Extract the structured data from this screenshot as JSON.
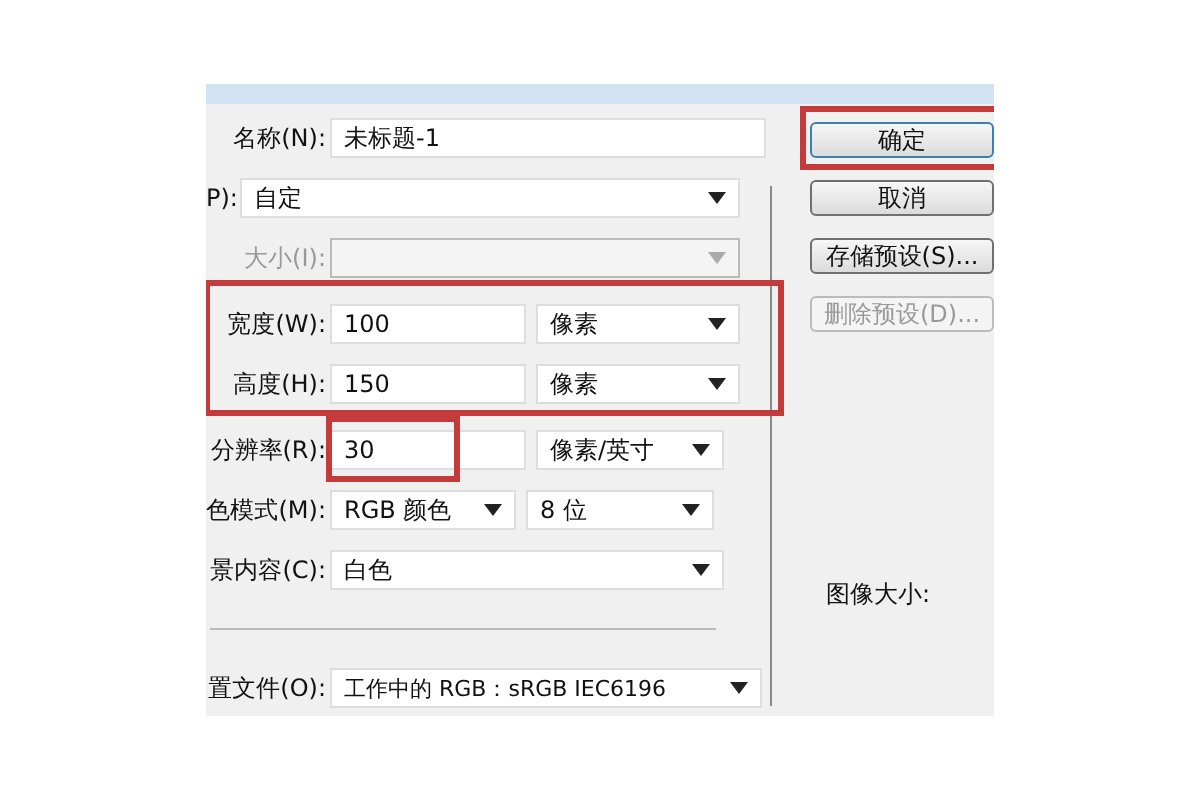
{
  "name": {
    "label": "名称(N):",
    "value": "未标题-1"
  },
  "preset": {
    "label": "P):",
    "value": "自定"
  },
  "size": {
    "label": "大小(I):",
    "disabled": true
  },
  "width": {
    "label": "宽度(W):",
    "value": "100",
    "unit": "像素"
  },
  "height": {
    "label": "高度(H):",
    "value": "150",
    "unit": "像素"
  },
  "size_marked": true,
  "resolution": {
    "label": "分辨率(R):",
    "value": "30",
    "unit": "像素/英寸",
    "marked": true
  },
  "color_mode": {
    "label": "色模式(M):",
    "value": "RGB 颜色",
    "unit": "8 位"
  },
  "background": {
    "label": "景内容(C):",
    "value": "白色"
  },
  "profile": {
    "label": "置文件(O):",
    "value": "工作中的 RGB：sRGB IEC6196"
  },
  "buttons": [
    {
      "label": "确定",
      "disabled": false,
      "marked": true
    },
    {
      "label": "取消",
      "disabled": false,
      "marked": false
    },
    {
      "label": "存储预设(S)...",
      "disabled": false,
      "marked": false
    },
    {
      "label": "删除预设(D)...",
      "disabled": true,
      "marked": false
    }
  ],
  "image_size_label": "图像大小:"
}
